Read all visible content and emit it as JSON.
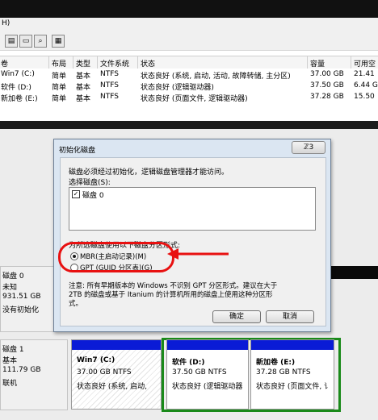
{
  "menu": {
    "partial": "H)"
  },
  "toolbar": {
    "icons": [
      "properties-icon",
      "open-folder-icon",
      "search-icon",
      "help-icon"
    ]
  },
  "volume_table": {
    "headers": [
      "卷",
      "布局",
      "类型",
      "文件系统",
      "状态",
      "容量",
      "可用空"
    ],
    "rows": [
      {
        "name": "Win7 (C:)",
        "layout": "简单",
        "type": "基本",
        "fs": "NTFS",
        "status": "状态良好 (系统, 启动, 活动, 故障转储, 主分区)",
        "capacity": "37.00 GB",
        "free": "21.41"
      },
      {
        "name": "软件 (D:)",
        "layout": "简单",
        "type": "基本",
        "fs": "NTFS",
        "status": "状态良好 (逻辑驱动器)",
        "capacity": "37.50 GB",
        "free": "6.44 G"
      },
      {
        "name": "新加卷 (E:)",
        "layout": "简单",
        "type": "基本",
        "fs": "NTFS",
        "status": "状态良好 (页面文件, 逻辑驱动器)",
        "capacity": "37.28 GB",
        "free": "15.50"
      }
    ]
  },
  "disks": [
    {
      "name": "磁盘 0",
      "kind": "未知",
      "size": "931.51 GB",
      "state": "没有初始化"
    },
    {
      "name": "磁盘 1",
      "kind": "基本",
      "size": "111.79 GB",
      "state": "联机"
    }
  ],
  "partitions": [
    {
      "name": "Win7  (C:)",
      "size": "37.00 GB NTFS",
      "status": "状态良好 (系统, 启动,"
    },
    {
      "name": "软件  (D:)",
      "size": "37.50 GB NTFS",
      "status": "状态良好 (逻辑驱动器"
    },
    {
      "name": "新加卷  (E:)",
      "size": "37.28 GB NTFS",
      "status": "状态良好 (页面文件, 讠"
    }
  ],
  "dialog": {
    "title": "初始化磁盘",
    "close_label": "ℤ3",
    "intro": "磁盘必须经过初始化，逻辑磁盘管理器才能访问。",
    "select_label": "选择磁盘(S):",
    "disk_item": "磁盘 0",
    "style_label": "为所选磁盘使用以下磁盘分区形式:",
    "mbr_label": "MBR(主启动记录)(M)",
    "gpt_label": "GPT (GUID 分区表)(G)",
    "note_line1": "注意: 所有早期版本的 Windows 不识别 GPT 分区形式。建议在大于",
    "note_line2": "2TB 的磁盘或基于 Itanium 的计算机所用的磁盘上使用这种分区形",
    "note_line3": "式。",
    "ok_label": "确定",
    "cancel_label": "取消"
  },
  "colors": {
    "partition_band": "#0a1bd6",
    "annotation": "#e81010",
    "selected_border": "#1a8a1a"
  }
}
